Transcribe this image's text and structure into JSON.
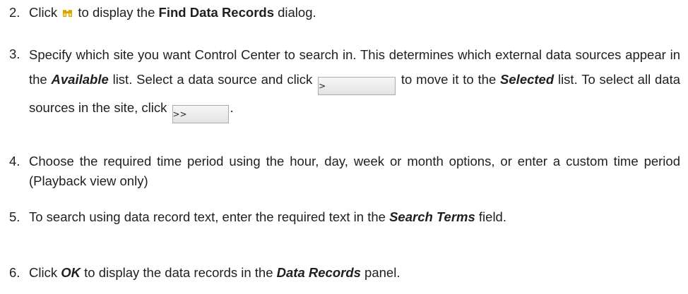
{
  "steps": [
    {
      "number": "2.",
      "prefix": "Click ",
      "icon": "binoculars-icon",
      "mid": " to display the ",
      "bold": "Find Data Records",
      "suffix": " dialog."
    },
    {
      "number": "3.",
      "t1": "Specify which site you want Control Center to search in. This determines which external data sources appear in the ",
      "e1": "Available",
      "t2": " list. Select a data source and click ",
      "btn1": ">",
      "t3": " to move it to the ",
      "e2": "Selected",
      "t4": " list. To select all data sources in the site, click ",
      "btn2": ">>",
      "t5": "."
    },
    {
      "number": "4.",
      "text": "Choose the required time period using the hour, day, week or month options, or enter a custom time period (Playback view only)"
    },
    {
      "number": "5.",
      "t1": "To search using data record text, enter the required text in the ",
      "e1": "Search Terms",
      "t2": " field."
    },
    {
      "number": "6.",
      "t1": "Click ",
      "e1": "OK",
      "t2": " to display the data records in the ",
      "e2": "Data Records",
      "t3": " panel."
    }
  ],
  "colors": {
    "text": "#1f1f1f",
    "icon": "#d9a400",
    "button_border": "#adadad"
  }
}
